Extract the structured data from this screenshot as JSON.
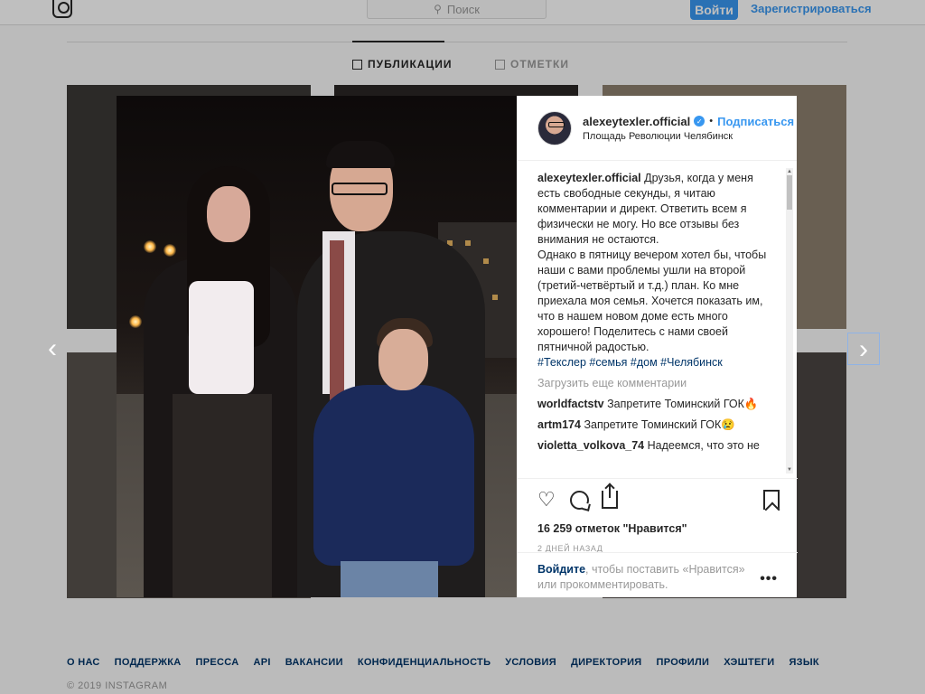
{
  "topbar": {
    "search_placeholder": "Поиск",
    "login_label": "Войти",
    "signup_label": "Зарегистрироваться"
  },
  "profile_tabs": [
    {
      "label": "ПУБЛИКАЦИИ",
      "active": true
    },
    {
      "label": "ОТМЕТКИ",
      "active": false
    }
  ],
  "post": {
    "username": "alexeytexler.official",
    "verified": true,
    "follow_label": "Подписаться",
    "location": "Площадь Революции Челябинск",
    "caption": "Друзья, когда у меня есть свободные секунды, я читаю комментарии и директ. Ответить всем я физически не могу. Но все отзывы без внимания не остаются.",
    "caption_2": "Однако в пятницу вечером хотел бы, чтобы наши с вами проблемы ушли на второй (третий-четвёртый и т.д.) план. Ко мне приехала моя семья. Хочется показать им, что в нашем новом доме есть много хорошего! Поделитесь с нами своей пятничной радостью.",
    "hashtags": "#Текслер #семья #дом #Челябинск",
    "load_more": "Загрузить еще комментарии",
    "comments": [
      {
        "author": "worldfactstv",
        "text": "Запретите Томинский ГОК",
        "emoji": "🔥"
      },
      {
        "author": "artm174",
        "text": "Запретите Томинский ГОК",
        "emoji": "😢"
      },
      {
        "author": "violetta_volkova_74",
        "text": "Надеемся, что это не"
      }
    ],
    "likes": "16 259 отметок \"Нравится\"",
    "time_ago": "2 ДНЕЙ НАЗАД",
    "login_link": "Войдите",
    "login_prompt": ", чтобы поставить «Нравится» или прокомментировать."
  },
  "nav": {
    "prev_glyph": "‹",
    "next_glyph": "›"
  },
  "footer": {
    "links": [
      "О НАС",
      "ПОДДЕРЖКА",
      "ПРЕССА",
      "API",
      "ВАКАНСИИ",
      "КОНФИДЕНЦИАЛЬНОСТЬ",
      "УСЛОВИЯ",
      "ДИРЕКТОРИЯ",
      "ПРОФИЛИ",
      "ХЭШТЕГИ",
      "ЯЗЫК"
    ],
    "copyright": "© 2019 INSTAGRAM"
  },
  "colors": {
    "accent": "#3897f0",
    "link_dark": "#003569",
    "text": "#262626",
    "muted": "#999999"
  },
  "icons": [
    "instagram-logo-icon",
    "search-icon",
    "verified-badge-icon",
    "heart-icon",
    "comment-icon",
    "share-icon",
    "bookmark-icon",
    "more-icon",
    "chevron-left-icon",
    "chevron-right-icon"
  ]
}
